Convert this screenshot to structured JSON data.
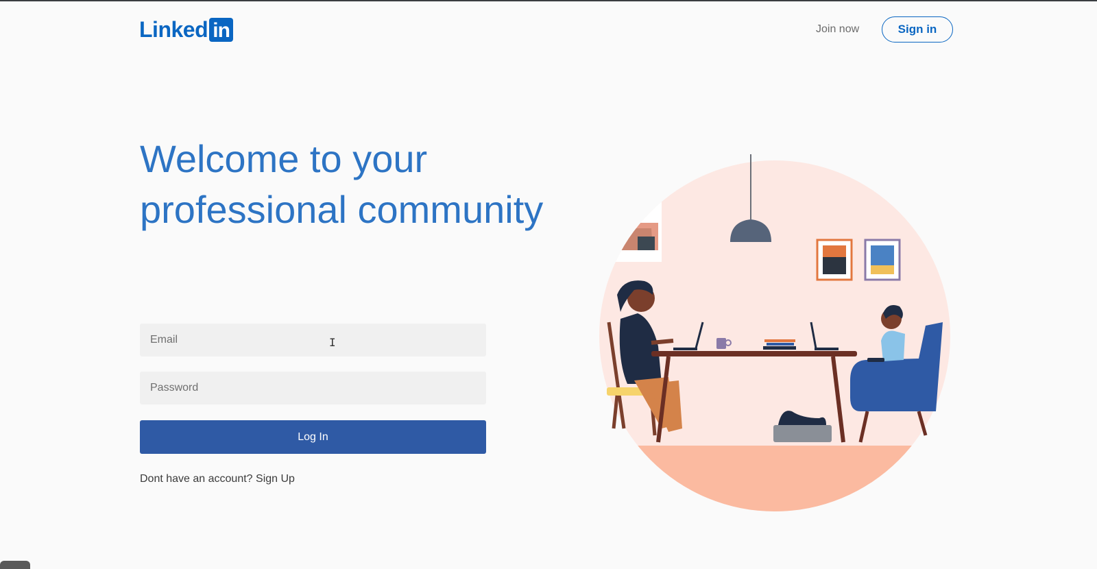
{
  "header": {
    "logo_text": "Linked",
    "logo_box": "in",
    "join_now": "Join now",
    "sign_in": "Sign in"
  },
  "hero": {
    "line1": "Welcome to your",
    "line2": "professional community"
  },
  "form": {
    "email_placeholder": "Email",
    "password_placeholder": "Password",
    "login_label": "Log In",
    "signup_prompt": "Dont have an account?",
    "signup_link": "Sign Up"
  },
  "colors": {
    "brand": "#0a66c2",
    "headline": "#2d74c4",
    "button": "#2f5aa5",
    "field_bg": "#f0f0f0"
  },
  "icons": {
    "cursor": "text-cursor-icon",
    "illustration": "people-working-at-table-illustration"
  }
}
